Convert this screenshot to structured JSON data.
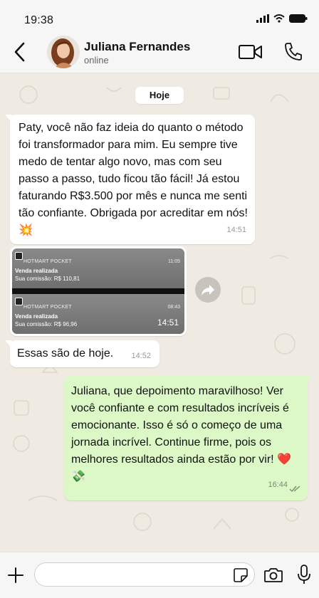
{
  "status": {
    "time": "19:38"
  },
  "header": {
    "name": "Juliana Fernandes",
    "status": "online"
  },
  "chat": {
    "date_chip": "Hoje",
    "messages": [
      {
        "text": "Paty, você não faz ideia do quanto o método foi transformador para mim. Eu sempre tive medo de tentar algo novo, mas com seu passo a passo, tudo ficou tão fácil! Já estou faturando R$3.500 por mês e nunca me senti tão confiante. Obrigada por acreditar em nós! 💥",
        "time": "14:51"
      },
      {
        "time": "14:51",
        "notifications": [
          {
            "app": "HOTMART POCKET",
            "time": "11:05",
            "title": "Venda realizada",
            "body": "Sua comissão: R$ 110,81"
          },
          {
            "app": "HOTMART POCKET",
            "time": "08:43",
            "title": "Venda realizada",
            "body": "Sua comissão: R$ 96,96"
          }
        ]
      },
      {
        "text": "Essas são de hoje.",
        "time": "14:52"
      },
      {
        "text": "Juliana, que depoimento maravilhoso! Ver você confiante e com resultados incríveis é emocionante. Isso é só o começo de uma jornada incrível. Continue firme, pois os melhores resultados ainda estão por vir! ❤️ 💸",
        "time": "16:44"
      }
    ]
  },
  "input": {
    "placeholder": ""
  },
  "colors": {
    "chat_bg": "#efeae2",
    "incoming": "#ffffff",
    "outgoing": "#dcf8c6",
    "bar": "#f6f6f6"
  },
  "icons": [
    "back-icon",
    "avatar",
    "video-call-icon",
    "phone-icon",
    "forward-icon",
    "read-ticks-icon",
    "plus-icon",
    "sticker-icon",
    "camera-icon",
    "mic-icon",
    "signal-icon",
    "wifi-icon",
    "battery-icon"
  ]
}
